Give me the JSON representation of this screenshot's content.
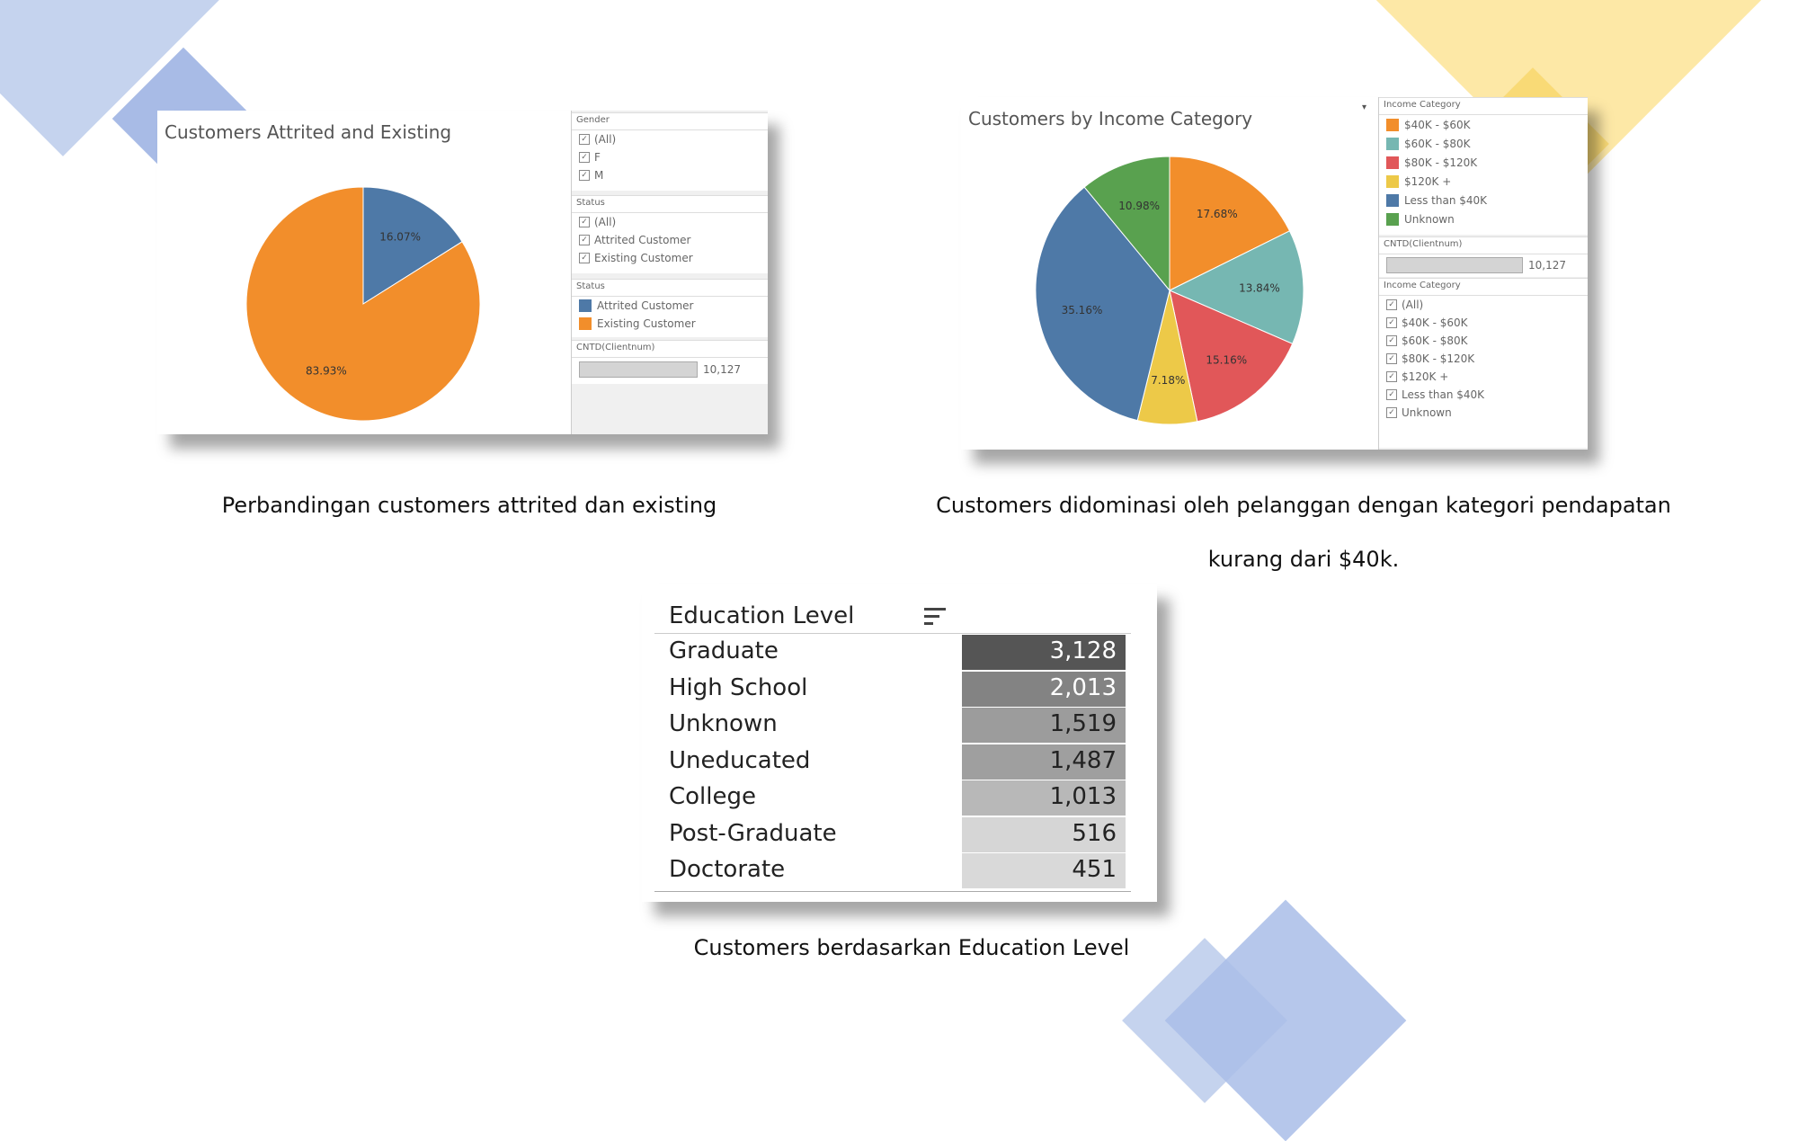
{
  "captions": {
    "attrition": "Perbandingan customers attrited dan existing",
    "income_line1": "Customers didominasi oleh pelanggan dengan kategori pendapatan",
    "income_line2": "kurang dari $40k.",
    "education": "Customers berdasarkan Education Level"
  },
  "attrition_panel": {
    "filters": [
      {
        "header": "Gender",
        "items": [
          "(All)",
          "F",
          "M"
        ]
      },
      {
        "header": "Status",
        "items": [
          "(All)",
          "Attrited Customer",
          "Existing Customer"
        ]
      }
    ],
    "legend_header": "Status",
    "legend": [
      {
        "label": "Attrited Customer",
        "color": "#4e79a7"
      },
      {
        "label": "Existing Customer",
        "color": "#f28e2b"
      }
    ],
    "count_header": "CNTD(Clientnum)",
    "count_value": "10,127",
    "count_fill": 1.0
  },
  "income_panel": {
    "legend_header": "Income Category",
    "legend": [
      {
        "label": "$40K - $60K",
        "color": "#f28e2b"
      },
      {
        "label": "$60K - $80K",
        "color": "#76b7b2"
      },
      {
        "label": "$80K - $120K",
        "color": "#e15759"
      },
      {
        "label": "$120K +",
        "color": "#edc948"
      },
      {
        "label": "Less than $40K",
        "color": "#4e79a7"
      },
      {
        "label": "Unknown",
        "color": "#59a14f"
      }
    ],
    "count_header": "CNTD(Clientnum)",
    "count_value": "10,127",
    "count_fill": 1.0,
    "filter_header": "Income Category",
    "filter_items": [
      "(All)",
      "$40K - $60K",
      "$60K - $80K",
      "$80K - $120K",
      "$120K +",
      "Less than $40K",
      "Unknown"
    ],
    "dropdown_arrow": "▾"
  },
  "chart_data": [
    {
      "type": "pie",
      "title": "Customers Attrited and Existing",
      "slices": [
        {
          "label": "Attrited Customer",
          "value": 16.07,
          "display": "16.07%",
          "color": "#4e79a7"
        },
        {
          "label": "Existing Customer",
          "value": 83.93,
          "display": "83.93%",
          "color": "#f28e2b"
        }
      ]
    },
    {
      "type": "pie",
      "title": "Customers by Income Category",
      "slices": [
        {
          "label": "$40K - $60K",
          "value": 17.68,
          "display": "17.68%",
          "color": "#f28e2b"
        },
        {
          "label": "$60K - $80K",
          "value": 13.84,
          "display": "13.84%",
          "color": "#76b7b2"
        },
        {
          "label": "$80K - $120K",
          "value": 15.16,
          "display": "15.16%",
          "color": "#e15759"
        },
        {
          "label": "$120K +",
          "value": 7.18,
          "display": "7.18%",
          "color": "#edc948"
        },
        {
          "label": "Less than $40K",
          "value": 35.16,
          "display": "35.16%",
          "color": "#4e79a7"
        },
        {
          "label": "Unknown",
          "value": 10.98,
          "display": "10.98%",
          "color": "#59a14f"
        }
      ]
    },
    {
      "type": "table",
      "title": "Education Level",
      "rows": [
        {
          "label": "Graduate",
          "value": 3128,
          "display": "3,128",
          "shade": "#555555",
          "text_color": "#ffffff"
        },
        {
          "label": "High School",
          "value": 2013,
          "display": "2,013",
          "shade": "#838383",
          "text_color": "#ffffff"
        },
        {
          "label": "Unknown",
          "value": 1519,
          "display": "1,519",
          "shade": "#9c9c9c",
          "text_color": "#222222"
        },
        {
          "label": "Uneducated",
          "value": 1487,
          "display": "1,487",
          "shade": "#9f9f9f",
          "text_color": "#222222"
        },
        {
          "label": "College",
          "value": 1013,
          "display": "1,013",
          "shade": "#b8b8b8",
          "text_color": "#222222"
        },
        {
          "label": "Post-Graduate",
          "value": 516,
          "display": "516",
          "shade": "#d6d6d6",
          "text_color": "#222222"
        },
        {
          "label": "Doctorate",
          "value": 451,
          "display": "451",
          "shade": "#d9d9d9",
          "text_color": "#222222"
        }
      ]
    }
  ]
}
